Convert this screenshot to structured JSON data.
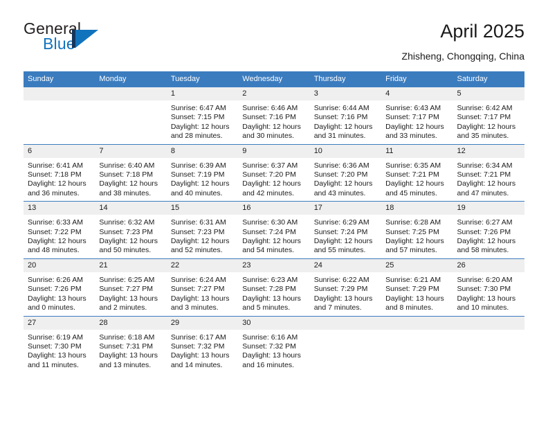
{
  "logo": {
    "word_general": "General",
    "word_blue": "Blue",
    "mark_name": "triangle-flag-logo",
    "colors": {
      "navy": "#14355c",
      "blue": "#1273bd",
      "dark": "#231f20"
    }
  },
  "header": {
    "title": "April 2025",
    "subtitle": "Zhisheng, Chongqing, China"
  },
  "theme": {
    "header_blue": "#3b7cbf",
    "daynum_band": "#efefef",
    "text": "#1a1a1a"
  },
  "calendar": {
    "weekday_headers": [
      "Sunday",
      "Monday",
      "Tuesday",
      "Wednesday",
      "Thursday",
      "Friday",
      "Saturday"
    ],
    "weeks": [
      [
        {
          "day": "",
          "lines": []
        },
        {
          "day": "",
          "lines": []
        },
        {
          "day": "1",
          "lines": [
            "Sunrise: 6:47 AM",
            "Sunset: 7:15 PM",
            "Daylight: 12 hours",
            "and 28 minutes."
          ]
        },
        {
          "day": "2",
          "lines": [
            "Sunrise: 6:46 AM",
            "Sunset: 7:16 PM",
            "Daylight: 12 hours",
            "and 30 minutes."
          ]
        },
        {
          "day": "3",
          "lines": [
            "Sunrise: 6:44 AM",
            "Sunset: 7:16 PM",
            "Daylight: 12 hours",
            "and 31 minutes."
          ]
        },
        {
          "day": "4",
          "lines": [
            "Sunrise: 6:43 AM",
            "Sunset: 7:17 PM",
            "Daylight: 12 hours",
            "and 33 minutes."
          ]
        },
        {
          "day": "5",
          "lines": [
            "Sunrise: 6:42 AM",
            "Sunset: 7:17 PM",
            "Daylight: 12 hours",
            "and 35 minutes."
          ]
        }
      ],
      [
        {
          "day": "6",
          "lines": [
            "Sunrise: 6:41 AM",
            "Sunset: 7:18 PM",
            "Daylight: 12 hours",
            "and 36 minutes."
          ]
        },
        {
          "day": "7",
          "lines": [
            "Sunrise: 6:40 AM",
            "Sunset: 7:18 PM",
            "Daylight: 12 hours",
            "and 38 minutes."
          ]
        },
        {
          "day": "8",
          "lines": [
            "Sunrise: 6:39 AM",
            "Sunset: 7:19 PM",
            "Daylight: 12 hours",
            "and 40 minutes."
          ]
        },
        {
          "day": "9",
          "lines": [
            "Sunrise: 6:37 AM",
            "Sunset: 7:20 PM",
            "Daylight: 12 hours",
            "and 42 minutes."
          ]
        },
        {
          "day": "10",
          "lines": [
            "Sunrise: 6:36 AM",
            "Sunset: 7:20 PM",
            "Daylight: 12 hours",
            "and 43 minutes."
          ]
        },
        {
          "day": "11",
          "lines": [
            "Sunrise: 6:35 AM",
            "Sunset: 7:21 PM",
            "Daylight: 12 hours",
            "and 45 minutes."
          ]
        },
        {
          "day": "12",
          "lines": [
            "Sunrise: 6:34 AM",
            "Sunset: 7:21 PM",
            "Daylight: 12 hours",
            "and 47 minutes."
          ]
        }
      ],
      [
        {
          "day": "13",
          "lines": [
            "Sunrise: 6:33 AM",
            "Sunset: 7:22 PM",
            "Daylight: 12 hours",
            "and 48 minutes."
          ]
        },
        {
          "day": "14",
          "lines": [
            "Sunrise: 6:32 AM",
            "Sunset: 7:23 PM",
            "Daylight: 12 hours",
            "and 50 minutes."
          ]
        },
        {
          "day": "15",
          "lines": [
            "Sunrise: 6:31 AM",
            "Sunset: 7:23 PM",
            "Daylight: 12 hours",
            "and 52 minutes."
          ]
        },
        {
          "day": "16",
          "lines": [
            "Sunrise: 6:30 AM",
            "Sunset: 7:24 PM",
            "Daylight: 12 hours",
            "and 54 minutes."
          ]
        },
        {
          "day": "17",
          "lines": [
            "Sunrise: 6:29 AM",
            "Sunset: 7:24 PM",
            "Daylight: 12 hours",
            "and 55 minutes."
          ]
        },
        {
          "day": "18",
          "lines": [
            "Sunrise: 6:28 AM",
            "Sunset: 7:25 PM",
            "Daylight: 12 hours",
            "and 57 minutes."
          ]
        },
        {
          "day": "19",
          "lines": [
            "Sunrise: 6:27 AM",
            "Sunset: 7:26 PM",
            "Daylight: 12 hours",
            "and 58 minutes."
          ]
        }
      ],
      [
        {
          "day": "20",
          "lines": [
            "Sunrise: 6:26 AM",
            "Sunset: 7:26 PM",
            "Daylight: 13 hours",
            "and 0 minutes."
          ]
        },
        {
          "day": "21",
          "lines": [
            "Sunrise: 6:25 AM",
            "Sunset: 7:27 PM",
            "Daylight: 13 hours",
            "and 2 minutes."
          ]
        },
        {
          "day": "22",
          "lines": [
            "Sunrise: 6:24 AM",
            "Sunset: 7:27 PM",
            "Daylight: 13 hours",
            "and 3 minutes."
          ]
        },
        {
          "day": "23",
          "lines": [
            "Sunrise: 6:23 AM",
            "Sunset: 7:28 PM",
            "Daylight: 13 hours",
            "and 5 minutes."
          ]
        },
        {
          "day": "24",
          "lines": [
            "Sunrise: 6:22 AM",
            "Sunset: 7:29 PM",
            "Daylight: 13 hours",
            "and 7 minutes."
          ]
        },
        {
          "day": "25",
          "lines": [
            "Sunrise: 6:21 AM",
            "Sunset: 7:29 PM",
            "Daylight: 13 hours",
            "and 8 minutes."
          ]
        },
        {
          "day": "26",
          "lines": [
            "Sunrise: 6:20 AM",
            "Sunset: 7:30 PM",
            "Daylight: 13 hours",
            "and 10 minutes."
          ]
        }
      ],
      [
        {
          "day": "27",
          "lines": [
            "Sunrise: 6:19 AM",
            "Sunset: 7:30 PM",
            "Daylight: 13 hours",
            "and 11 minutes."
          ]
        },
        {
          "day": "28",
          "lines": [
            "Sunrise: 6:18 AM",
            "Sunset: 7:31 PM",
            "Daylight: 13 hours",
            "and 13 minutes."
          ]
        },
        {
          "day": "29",
          "lines": [
            "Sunrise: 6:17 AM",
            "Sunset: 7:32 PM",
            "Daylight: 13 hours",
            "and 14 minutes."
          ]
        },
        {
          "day": "30",
          "lines": [
            "Sunrise: 6:16 AM",
            "Sunset: 7:32 PM",
            "Daylight: 13 hours",
            "and 16 minutes."
          ]
        },
        {
          "day": "",
          "lines": []
        },
        {
          "day": "",
          "lines": []
        },
        {
          "day": "",
          "lines": []
        }
      ]
    ]
  }
}
